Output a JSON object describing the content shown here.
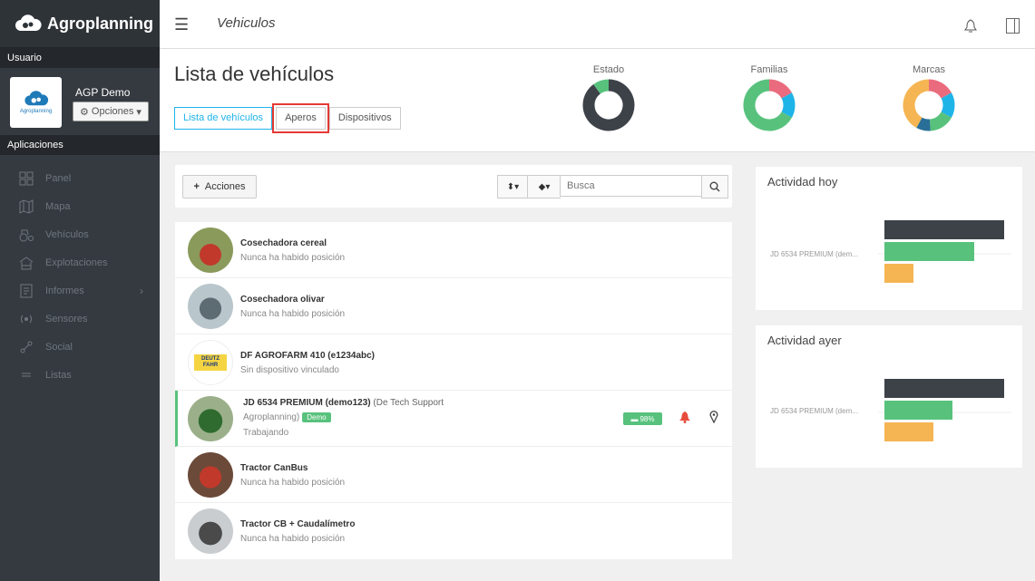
{
  "app": {
    "brand": "Agroplanning",
    "page_section": "Vehiculos"
  },
  "sidebar": {
    "user_header": "Usuario",
    "avatar_text": "Agroplanning",
    "username": "AGP Demo",
    "options_label": "Opciones",
    "apps_header": "Aplicaciones",
    "items": [
      {
        "label": "Panel",
        "icon": "grid-icon"
      },
      {
        "label": "Mapa",
        "icon": "map-icon"
      },
      {
        "label": "Vehículos",
        "icon": "tractor-icon"
      },
      {
        "label": "Explotaciones",
        "icon": "farm-icon"
      },
      {
        "label": "Informes",
        "icon": "report-icon"
      },
      {
        "label": "Sensores",
        "icon": "sensor-icon"
      },
      {
        "label": "Social",
        "icon": "social-icon"
      },
      {
        "label": "Listas",
        "icon": "list-icon"
      }
    ]
  },
  "header": {
    "title": "Lista de vehículos",
    "tabs": [
      {
        "label": "Lista de vehículos"
      },
      {
        "label": "Aperos"
      },
      {
        "label": "Dispositivos"
      }
    ],
    "donuts": [
      {
        "label": "Estado",
        "slices": [
          {
            "fraction": 0.9,
            "color": "#3d4249"
          },
          {
            "fraction": 0.1,
            "color": "#58c27d"
          }
        ]
      },
      {
        "label": "Familias",
        "slices": [
          {
            "fraction": 0.17,
            "color": "#e96b7d"
          },
          {
            "fraction": 0.16,
            "color": "#1fb4e8"
          },
          {
            "fraction": 0.67,
            "color": "#58c27d"
          }
        ]
      },
      {
        "label": "Marcas",
        "slices": [
          {
            "fraction": 0.17,
            "color": "#e96b7d"
          },
          {
            "fraction": 0.16,
            "color": "#1fb4e8"
          },
          {
            "fraction": 0.16,
            "color": "#58c27d"
          },
          {
            "fraction": 0.09,
            "color": "#2a6f97"
          },
          {
            "fraction": 0.42,
            "color": "#f5b553"
          }
        ]
      }
    ]
  },
  "toolbar": {
    "actions_label": "Acciones",
    "search_placeholder": "Busca"
  },
  "vehicles": [
    {
      "name": "Cosechadora cereal",
      "status": "Nunca ha habido posición"
    },
    {
      "name": "Cosechadora olivar",
      "status": "Nunca ha habido posición"
    },
    {
      "name": "DF AGROFARM 410 (e1234abc)",
      "status": "Sin dispositivo vinculado",
      "logo_text": "DEUTZ FAHR"
    },
    {
      "name": "JD 6534 PREMIUM (demo123)",
      "owner_a": "(De Tech Support",
      "owner_b": "Agroplanning)",
      "badge": "Demo",
      "status": "Trabajando",
      "battery": "98%"
    },
    {
      "name": "Tractor CanBus",
      "status": "Nunca ha habido posición"
    },
    {
      "name": "Tractor CB + Caudalímetro",
      "status": "Nunca ha habido posición"
    }
  ],
  "activity_today": {
    "title": "Actividad hoy",
    "vehicle_label": "JD 6534 PREMIUM (dem...",
    "bars": [
      {
        "fraction": 1.0,
        "color": "#3d4249"
      },
      {
        "fraction": 0.75,
        "color": "#58c27d"
      },
      {
        "fraction": 0.24,
        "color": "#f5b553"
      }
    ]
  },
  "activity_yesterday": {
    "title": "Actividad ayer",
    "vehicle_label": "JD 6534 PREMIUM (dem...",
    "bars": [
      {
        "fraction": 1.0,
        "color": "#3d4249"
      },
      {
        "fraction": 0.57,
        "color": "#58c27d"
      },
      {
        "fraction": 0.41,
        "color": "#f5b553"
      }
    ]
  }
}
